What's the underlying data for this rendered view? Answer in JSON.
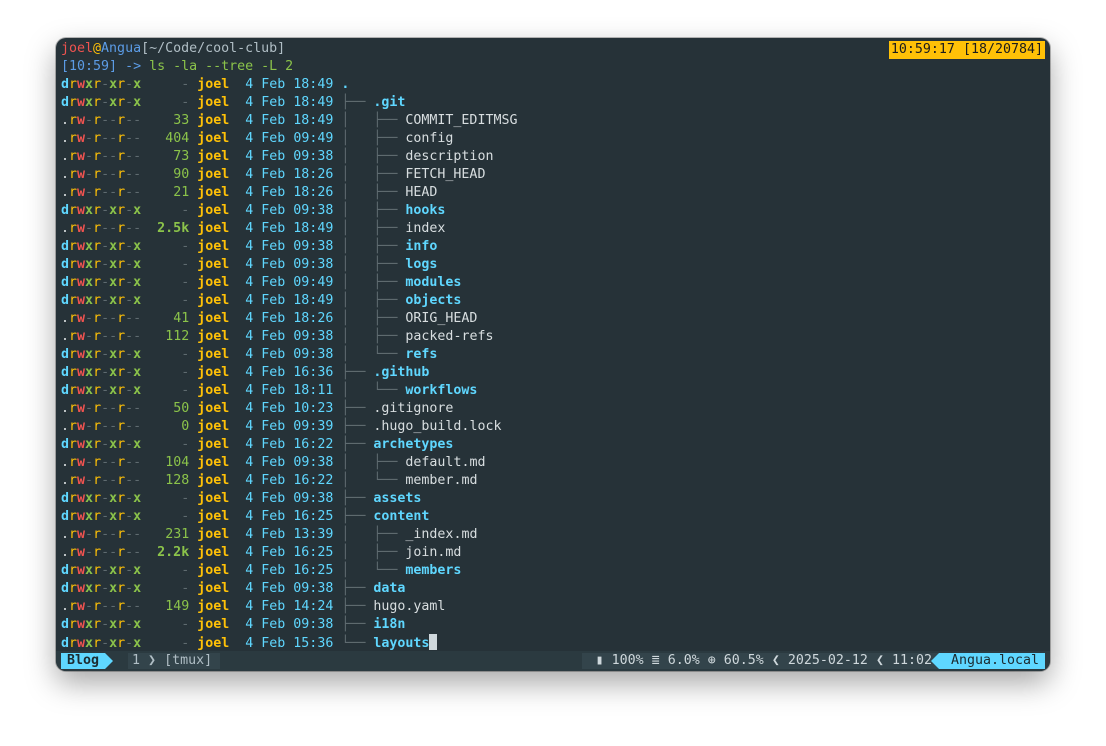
{
  "prompt": {
    "user": "joel",
    "at": "@",
    "host": "Angua",
    "path": "[~/Code/cool-club]",
    "time": "[10:59]",
    "arrow": "->",
    "command": "ls -la --tree -L 2"
  },
  "clock_badge": "10:59:17 [18/20784]",
  "rows": [
    {
      "perms": "drwxr-xr-x",
      "size": "-",
      "user": "joel",
      "date": "4 Feb 18:49",
      "tree": "",
      "name": ".",
      "dir": true
    },
    {
      "perms": "drwxr-xr-x",
      "size": "-",
      "user": "joel",
      "date": "4 Feb 18:49",
      "tree": "├── ",
      "name": ".git",
      "dir": true
    },
    {
      "perms": ".rw-r--r--",
      "size": "33",
      "user": "joel",
      "date": "4 Feb 18:49",
      "tree": "│   ├── ",
      "name": "COMMIT_EDITMSG",
      "dir": false
    },
    {
      "perms": ".rw-r--r--",
      "size": "404",
      "user": "joel",
      "date": "4 Feb 09:49",
      "tree": "│   ├── ",
      "name": "config",
      "dir": false
    },
    {
      "perms": ".rw-r--r--",
      "size": "73",
      "user": "joel",
      "date": "4 Feb 09:38",
      "tree": "│   ├── ",
      "name": "description",
      "dir": false
    },
    {
      "perms": ".rw-r--r--",
      "size": "90",
      "user": "joel",
      "date": "4 Feb 18:26",
      "tree": "│   ├── ",
      "name": "FETCH_HEAD",
      "dir": false
    },
    {
      "perms": ".rw-r--r--",
      "size": "21",
      "user": "joel",
      "date": "4 Feb 18:26",
      "tree": "│   ├── ",
      "name": "HEAD",
      "dir": false
    },
    {
      "perms": "drwxr-xr-x",
      "size": "-",
      "user": "joel",
      "date": "4 Feb 09:38",
      "tree": "│   ├── ",
      "name": "hooks",
      "dir": true
    },
    {
      "perms": ".rw-r--r--",
      "size": "2.5k",
      "user": "joel",
      "date": "4 Feb 18:49",
      "tree": "│   ├── ",
      "name": "index",
      "dir": false
    },
    {
      "perms": "drwxr-xr-x",
      "size": "-",
      "user": "joel",
      "date": "4 Feb 09:38",
      "tree": "│   ├── ",
      "name": "info",
      "dir": true
    },
    {
      "perms": "drwxr-xr-x",
      "size": "-",
      "user": "joel",
      "date": "4 Feb 09:38",
      "tree": "│   ├── ",
      "name": "logs",
      "dir": true
    },
    {
      "perms": "drwxr-xr-x",
      "size": "-",
      "user": "joel",
      "date": "4 Feb 09:49",
      "tree": "│   ├── ",
      "name": "modules",
      "dir": true
    },
    {
      "perms": "drwxr-xr-x",
      "size": "-",
      "user": "joel",
      "date": "4 Feb 18:49",
      "tree": "│   ├── ",
      "name": "objects",
      "dir": true
    },
    {
      "perms": ".rw-r--r--",
      "size": "41",
      "user": "joel",
      "date": "4 Feb 18:26",
      "tree": "│   ├── ",
      "name": "ORIG_HEAD",
      "dir": false
    },
    {
      "perms": ".rw-r--r--",
      "size": "112",
      "user": "joel",
      "date": "4 Feb 09:38",
      "tree": "│   ├── ",
      "name": "packed-refs",
      "dir": false
    },
    {
      "perms": "drwxr-xr-x",
      "size": "-",
      "user": "joel",
      "date": "4 Feb 09:38",
      "tree": "│   └── ",
      "name": "refs",
      "dir": true
    },
    {
      "perms": "drwxr-xr-x",
      "size": "-",
      "user": "joel",
      "date": "4 Feb 16:36",
      "tree": "├── ",
      "name": ".github",
      "dir": true
    },
    {
      "perms": "drwxr-xr-x",
      "size": "-",
      "user": "joel",
      "date": "4 Feb 18:11",
      "tree": "│   └── ",
      "name": "workflows",
      "dir": true
    },
    {
      "perms": ".rw-r--r--",
      "size": "50",
      "user": "joel",
      "date": "4 Feb 10:23",
      "tree": "├── ",
      "name": ".gitignore",
      "dir": false
    },
    {
      "perms": ".rw-r--r--",
      "size": "0",
      "user": "joel",
      "date": "4 Feb 09:39",
      "tree": "├── ",
      "name": ".hugo_build.lock",
      "dir": false
    },
    {
      "perms": "drwxr-xr-x",
      "size": "-",
      "user": "joel",
      "date": "4 Feb 16:22",
      "tree": "├── ",
      "name": "archetypes",
      "dir": true
    },
    {
      "perms": ".rw-r--r--",
      "size": "104",
      "user": "joel",
      "date": "4 Feb 09:38",
      "tree": "│   ├── ",
      "name": "default.md",
      "dir": false
    },
    {
      "perms": ".rw-r--r--",
      "size": "128",
      "user": "joel",
      "date": "4 Feb 16:22",
      "tree": "│   └── ",
      "name": "member.md",
      "dir": false
    },
    {
      "perms": "drwxr-xr-x",
      "size": "-",
      "user": "joel",
      "date": "4 Feb 09:38",
      "tree": "├── ",
      "name": "assets",
      "dir": true
    },
    {
      "perms": "drwxr-xr-x",
      "size": "-",
      "user": "joel",
      "date": "4 Feb 16:25",
      "tree": "├── ",
      "name": "content",
      "dir": true
    },
    {
      "perms": ".rw-r--r--",
      "size": "231",
      "user": "joel",
      "date": "4 Feb 13:39",
      "tree": "│   ├── ",
      "name": "_index.md",
      "dir": false
    },
    {
      "perms": ".rw-r--r--",
      "size": "2.2k",
      "user": "joel",
      "date": "4 Feb 16:25",
      "tree": "│   ├── ",
      "name": "join.md",
      "dir": false
    },
    {
      "perms": "drwxr-xr-x",
      "size": "-",
      "user": "joel",
      "date": "4 Feb 16:25",
      "tree": "│   └── ",
      "name": "members",
      "dir": true
    },
    {
      "perms": "drwxr-xr-x",
      "size": "-",
      "user": "joel",
      "date": "4 Feb 09:38",
      "tree": "├── ",
      "name": "data",
      "dir": true
    },
    {
      "perms": ".rw-r--r--",
      "size": "149",
      "user": "joel",
      "date": "4 Feb 14:24",
      "tree": "├── ",
      "name": "hugo.yaml",
      "dir": false
    },
    {
      "perms": "drwxr-xr-x",
      "size": "-",
      "user": "joel",
      "date": "4 Feb 09:38",
      "tree": "├── ",
      "name": "i18n",
      "dir": true
    },
    {
      "perms": "drwxr-xr-x",
      "size": "-",
      "user": "joel",
      "date": "4 Feb 15:36",
      "tree": "└── ",
      "name": "layouts",
      "dir": true
    }
  ],
  "statusbar": {
    "session": "Blog",
    "window_index": "1",
    "window_name": "[tmux]",
    "battery_icon": "battery-icon",
    "battery": "100%",
    "memory_icon": "memory-icon",
    "memory": "6.0%",
    "cpu_icon": "cpu-icon",
    "cpu": "60.5%",
    "date": "2025-02-12",
    "time": "11:02",
    "hostname": "Angua.local"
  },
  "colors": {
    "background": "#263238",
    "accent": "#5fd7ff",
    "badge": "#ffc107"
  }
}
